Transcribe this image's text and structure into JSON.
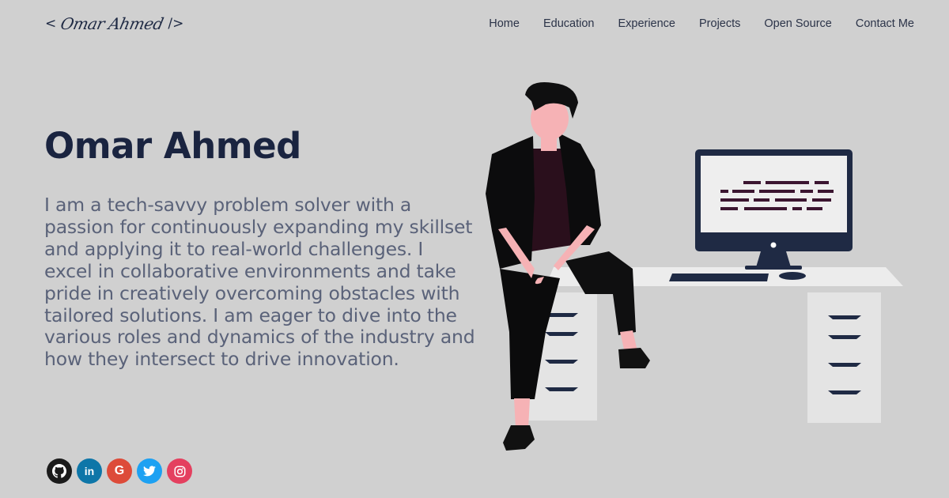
{
  "header": {
    "logo_open": "<",
    "logo_name": "Omar Ahmed",
    "logo_close": "/>",
    "nav": [
      "Home",
      "Education",
      "Experience",
      "Projects",
      "Open Source",
      "Contact Me"
    ]
  },
  "hero": {
    "name": "Omar Ahmed",
    "bio": "I am a tech-savvy problem solver with a passion for continuously expanding my skillset and applying it to real-world challenges. I excel in collaborative environments and take pride in creatively overcoming obstacles with tailored solutions. I am eager to dive into the various roles and dynamics of the industry and how they intersect to drive innovation."
  },
  "socials": [
    {
      "name": "github-icon",
      "color": "#1b1b1b"
    },
    {
      "name": "linkedin-icon",
      "color": "#0e76a8",
      "glyph": "in"
    },
    {
      "name": "google-icon",
      "color": "#dd4b39",
      "glyph": "G"
    },
    {
      "name": "twitter-icon",
      "color": "#1da1f2"
    },
    {
      "name": "instagram-icon",
      "color": "#e4405f"
    }
  ],
  "colors": {
    "background": "#d0d0d0",
    "heading": "#1a2440",
    "body_text": "#5a6279",
    "navy": "#1f2a44"
  }
}
